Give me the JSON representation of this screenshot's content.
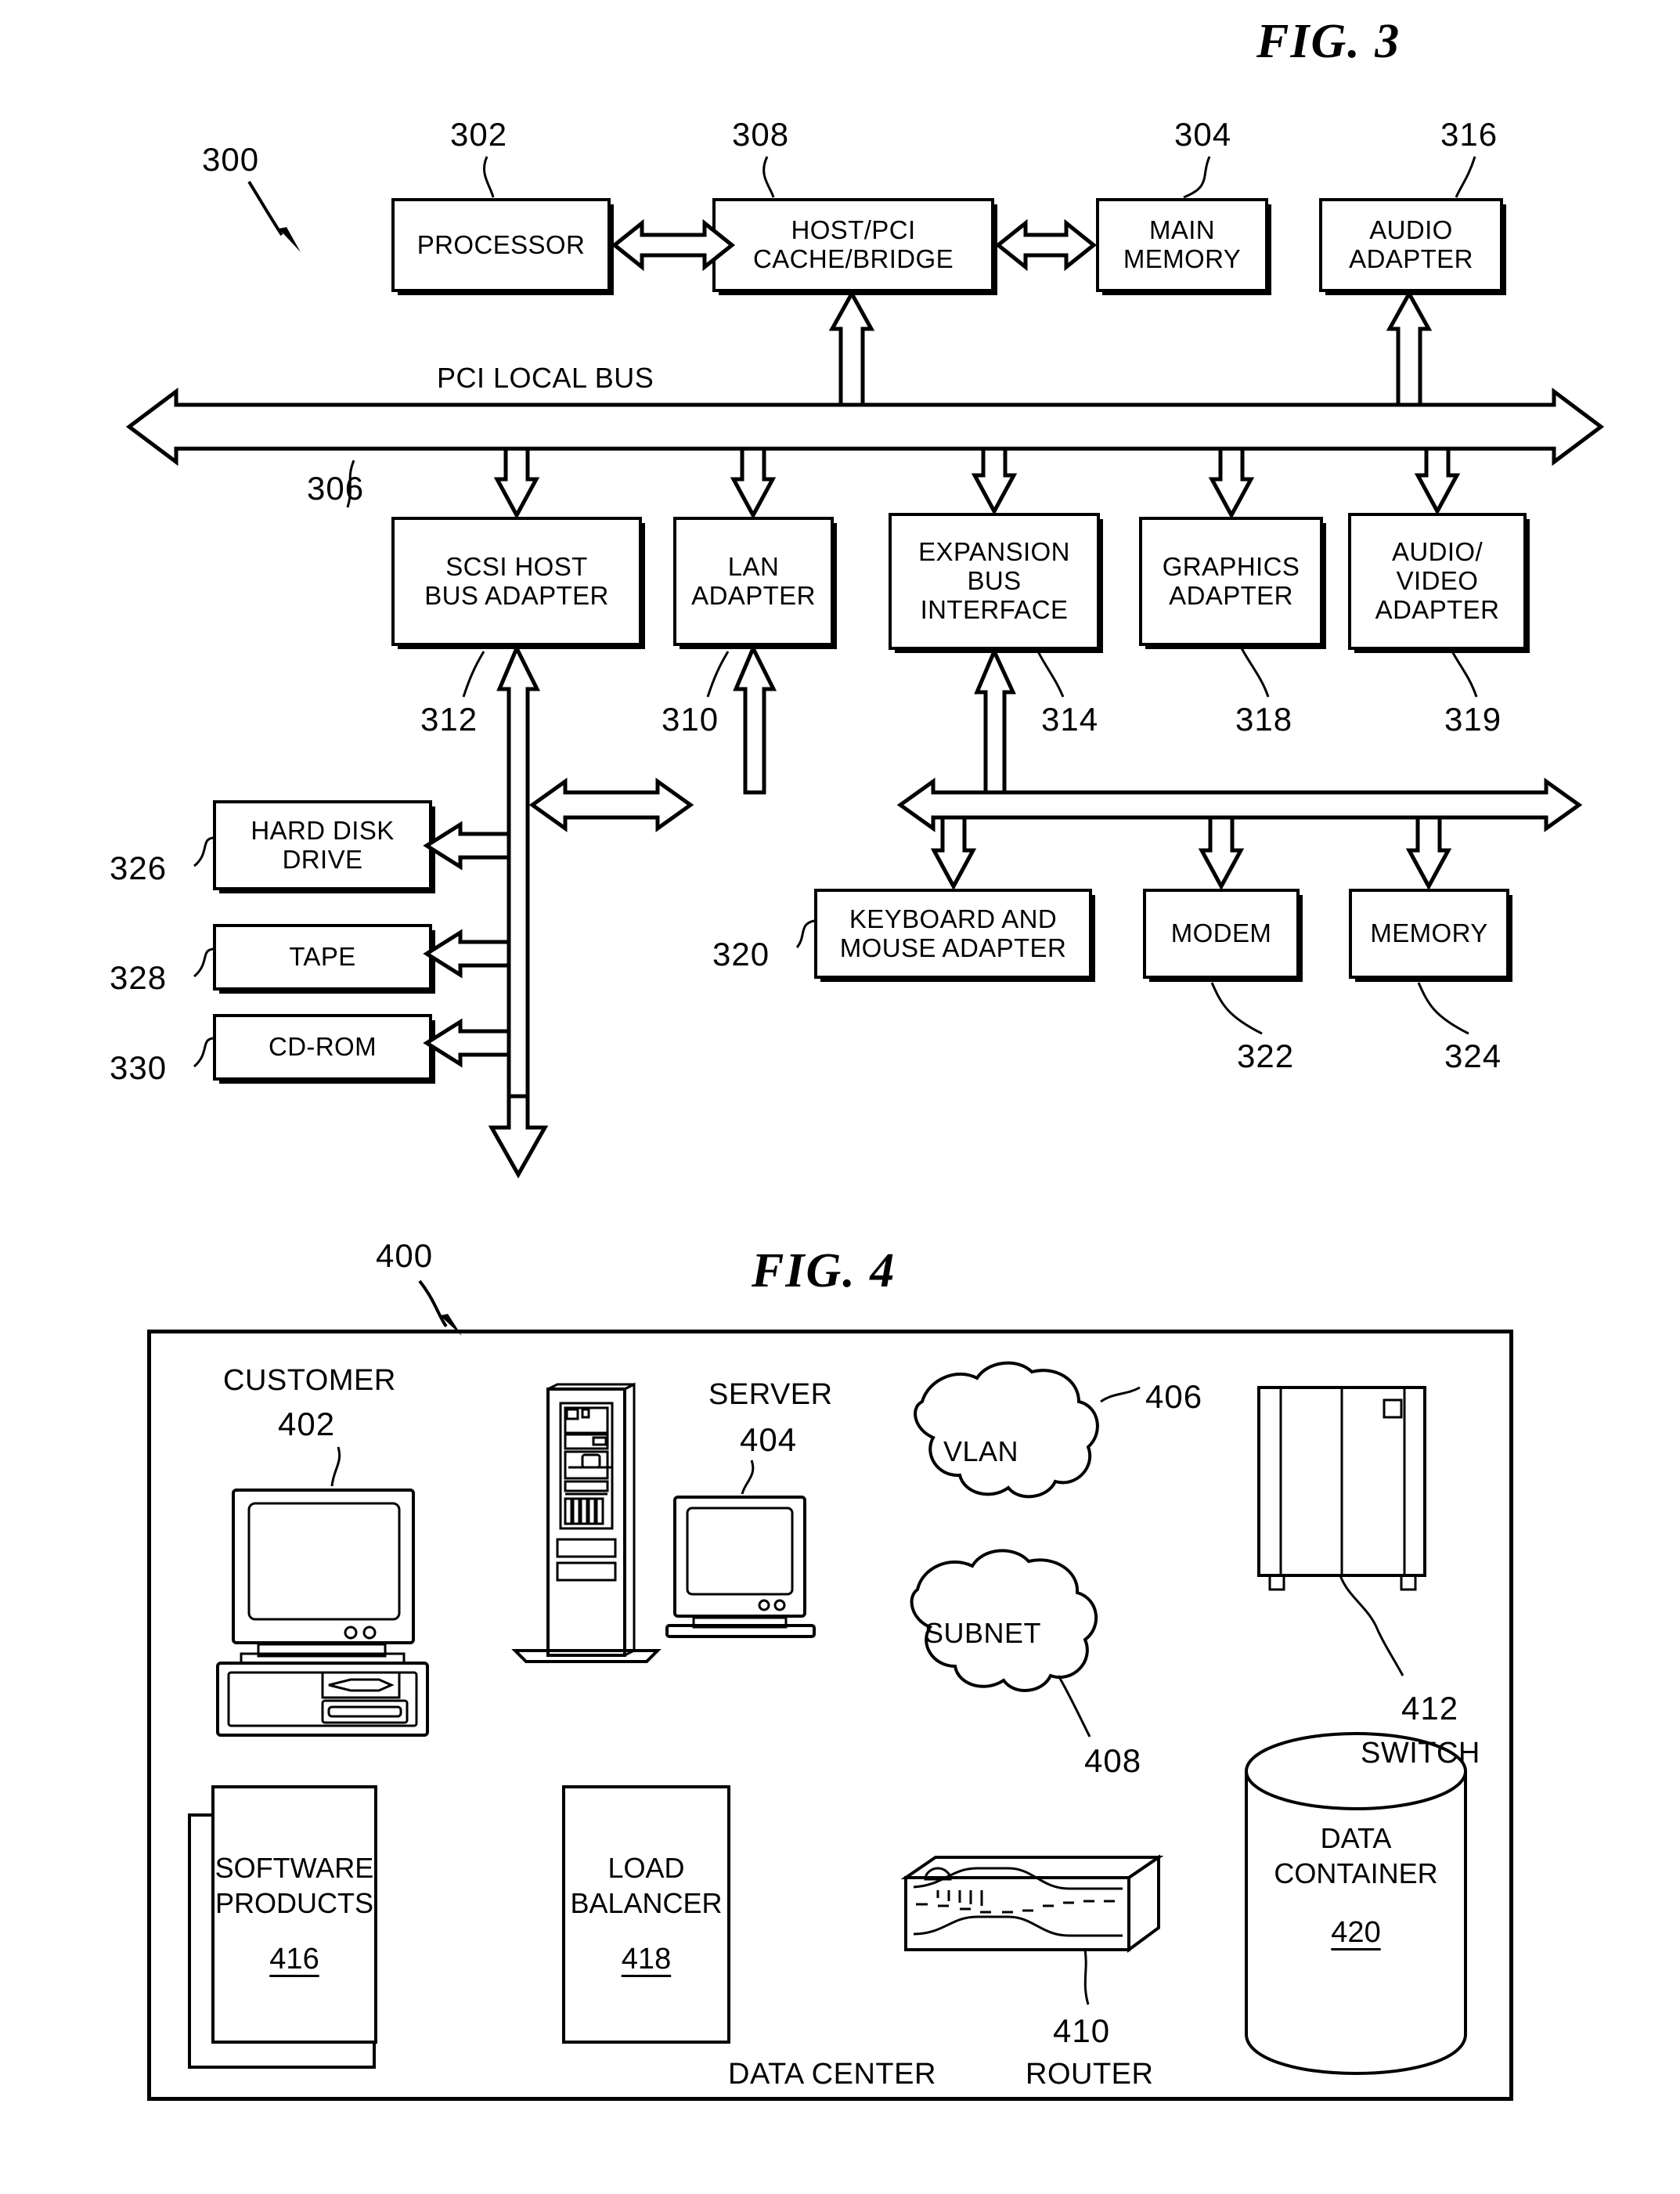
{
  "figures": [
    {
      "title": "FIG. 3",
      "system_ref": "300",
      "bus_label": "PCI LOCAL BUS",
      "bus_ref": "306",
      "top_row": [
        {
          "label": "PROCESSOR",
          "ref": "302"
        },
        {
          "label": "HOST/PCI\nCACHE/BRIDGE",
          "ref": "308"
        },
        {
          "label": "MAIN\nMEMORY",
          "ref": "304"
        },
        {
          "label": "AUDIO\nADAPTER",
          "ref": "316"
        }
      ],
      "adapter_row": [
        {
          "label": "SCSI HOST\nBUS ADAPTER",
          "ref": "312"
        },
        {
          "label": "LAN\nADAPTER",
          "ref": "310"
        },
        {
          "label": "EXPANSION\nBUS\nINTERFACE",
          "ref": "314"
        },
        {
          "label": "GRAPHICS\nADAPTER",
          "ref": "318"
        },
        {
          "label": "AUDIO/\nVIDEO\nADAPTER",
          "ref": "319"
        }
      ],
      "storage_row": [
        {
          "label": "HARD DISK\nDRIVE",
          "ref": "326"
        },
        {
          "label": "TAPE",
          "ref": "328"
        },
        {
          "label": "CD-ROM",
          "ref": "330"
        }
      ],
      "peripheral_row": [
        {
          "label": "KEYBOARD AND\nMOUSE ADAPTER",
          "ref": "320"
        },
        {
          "label": "MODEM",
          "ref": "322"
        },
        {
          "label": "MEMORY",
          "ref": "324"
        }
      ]
    },
    {
      "title": "FIG. 4",
      "system_ref": "400",
      "caption": "DATA CENTER",
      "nodes": [
        {
          "name": "CUSTOMER",
          "ref": "402",
          "kind": "desktop-computer"
        },
        {
          "name": "SERVER",
          "ref": "404",
          "kind": "server-tower-and-monitor"
        },
        {
          "name": "VLAN",
          "ref": "406",
          "kind": "cloud"
        },
        {
          "name": "SUBNET",
          "ref": "408",
          "kind": "cloud"
        },
        {
          "name": "SWITCH",
          "ref": "412",
          "kind": "switch-cabinet"
        },
        {
          "name": "ROUTER",
          "ref": "410",
          "kind": "router-device"
        }
      ],
      "boxes": [
        {
          "label": "SOFTWARE\nPRODUCTS",
          "ref": "416",
          "kind": "stacked-document"
        },
        {
          "label": "LOAD\nBALANCER",
          "ref": "418",
          "kind": "plain-box"
        },
        {
          "label": "DATA\nCONTAINER",
          "ref": "420",
          "kind": "cylinder"
        }
      ]
    }
  ],
  "fig3": {
    "title": "FIG. 3",
    "ref300": "300",
    "ref302": "302",
    "ref304": "304",
    "ref306": "306",
    "ref308": "308",
    "ref310": "310",
    "ref312": "312",
    "ref314": "314",
    "ref316": "316",
    "ref318": "318",
    "ref319": "319",
    "ref320": "320",
    "ref322": "322",
    "ref324": "324",
    "ref326": "326",
    "ref328": "328",
    "ref330": "330",
    "processor": "PROCESSOR",
    "host_pci_1": "HOST/PCI",
    "host_pci_2": "CACHE/BRIDGE",
    "main_memory_1": "MAIN",
    "main_memory_2": "MEMORY",
    "audio_adapter_1": "AUDIO",
    "audio_adapter_2": "ADAPTER",
    "pci_local_bus": "PCI LOCAL BUS",
    "scsi_1": "SCSI HOST",
    "scsi_2": "BUS ADAPTER",
    "lan_1": "LAN",
    "lan_2": "ADAPTER",
    "expansion_1": "EXPANSION",
    "expansion_2": "BUS",
    "expansion_3": "INTERFACE",
    "graphics_1": "GRAPHICS",
    "graphics_2": "ADAPTER",
    "av_1": "AUDIO/",
    "av_2": "VIDEO",
    "av_3": "ADAPTER",
    "hdd_1": "HARD DISK",
    "hdd_2": "DRIVE",
    "tape": "TAPE",
    "cdrom": "CD-ROM",
    "kbm_1": "KEYBOARD AND",
    "kbm_2": "MOUSE ADAPTER",
    "modem": "MODEM",
    "memory": "MEMORY"
  },
  "fig4": {
    "title": "FIG. 4",
    "ref400": "400",
    "ref402": "402",
    "ref404": "404",
    "ref406": "406",
    "ref408": "408",
    "ref410": "410",
    "ref412": "412",
    "customer": "CUSTOMER",
    "server": "SERVER",
    "vlan": "VLAN",
    "subnet": "SUBNET",
    "switch": "SWITCH",
    "router": "ROUTER",
    "data_center": "DATA CENTER",
    "sw_1": "SOFTWARE",
    "sw_2": "PRODUCTS",
    "sw_num": "416",
    "lb_1": "LOAD",
    "lb_2": "BALANCER",
    "lb_num": "418",
    "dc_1": "DATA",
    "dc_2": "CONTAINER",
    "dc_num": "420"
  }
}
